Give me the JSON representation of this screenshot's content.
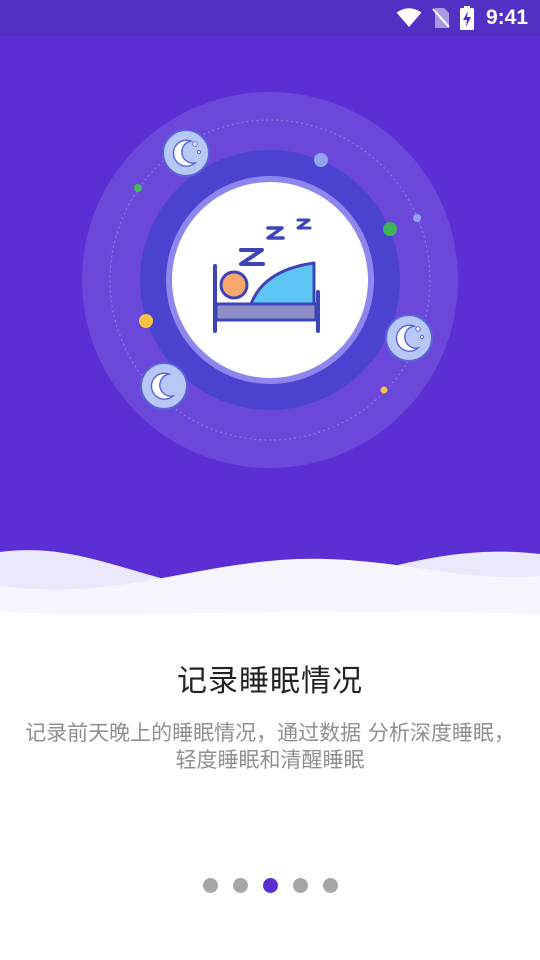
{
  "status_bar": {
    "time": "9:41",
    "icons": [
      "wifi-icon",
      "no-sim-icon",
      "battery-charging-icon"
    ]
  },
  "illustration": {
    "subject": "person-sleeping-in-bed-icon",
    "snore_letters": [
      "Z",
      "z",
      "z"
    ],
    "decorations": [
      "moon-icon",
      "moon-icon",
      "moon-icon"
    ]
  },
  "onboarding": {
    "title": "记录睡眠情况",
    "description": "记录前天晚上的睡眠情况，通过数据 分析深度睡眠，轻度睡眠和清醒睡眠"
  },
  "pagination": {
    "total": 5,
    "current": 3
  },
  "colors": {
    "accent": "#5b2fd3",
    "status_bar": "#5230c3",
    "inactive_dot": "#a6a6a6",
    "title_text": "#222222",
    "description_text": "#8f8f8f"
  }
}
